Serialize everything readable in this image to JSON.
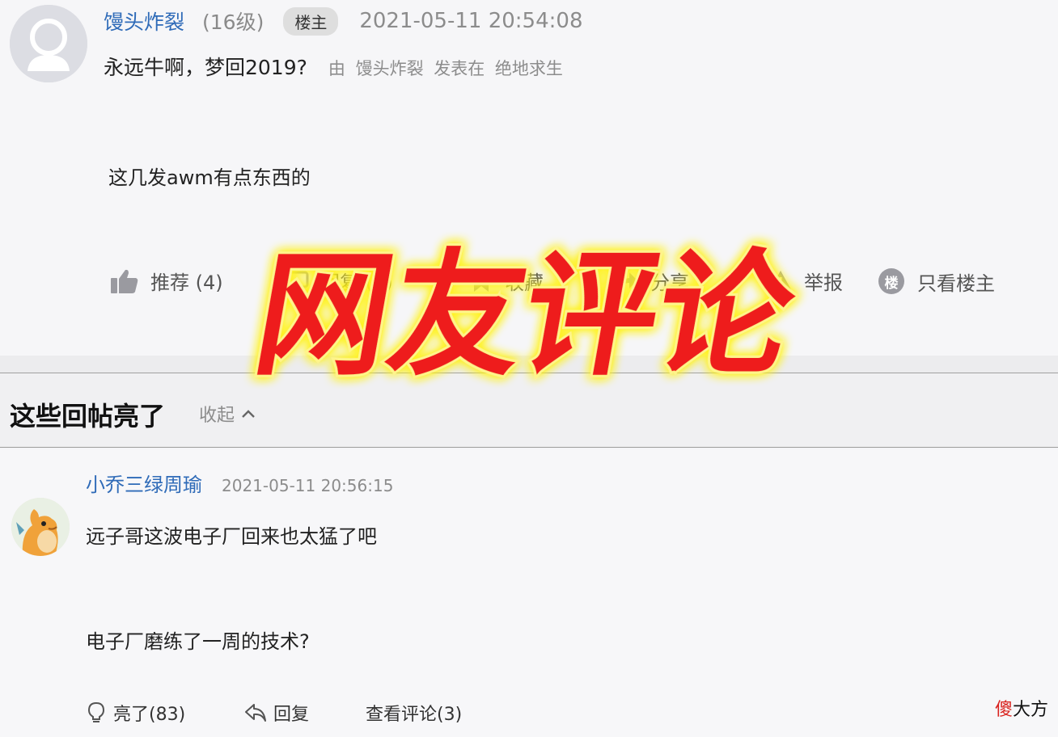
{
  "post": {
    "author": "馒头炸裂",
    "level": "(16级)",
    "op_badge": "楼主",
    "timestamp": "2021-05-11 20:54:08",
    "title": "永远牛啊，梦回2019?",
    "meta": "由 馒头炸裂 发表在 绝地求生",
    "body": "这几发awm有点东西的",
    "actions": {
      "recommend": "推荐 (4)",
      "reply": "回复 (1)",
      "favorite": "收藏",
      "share": "分享",
      "report": "举报",
      "only_op": "只看楼主",
      "only_op_icon_char": "楼"
    }
  },
  "overlay_text": "网友评论",
  "hot_section": {
    "title": "这些回帖亮了",
    "collapse": "收起",
    "collapse_icon": "^"
  },
  "reply": {
    "author": "小乔三绿周瑜",
    "timestamp": "2021-05-11 20:56:15",
    "line1": "远子哥这波电子厂回来也太猛了吧",
    "line2": "电子厂磨练了一周的技术?",
    "actions": {
      "light": "亮了(83)",
      "reply": "回复",
      "view_comments": "查看评论(3)"
    }
  },
  "watermark": {
    "first": "傻",
    "rest": "大方"
  },
  "colors": {
    "username": "#2f6bb8",
    "overlay_fill": "#ee1d1d",
    "overlay_glow": "#fff21a"
  },
  "icons": {
    "op_avatar": "default-user-avatar",
    "reply_avatar": "dragon-avatar",
    "recommend": "thumbs-up-icon",
    "light": "lightbulb-icon",
    "reply": "reply-arrow-icon"
  }
}
